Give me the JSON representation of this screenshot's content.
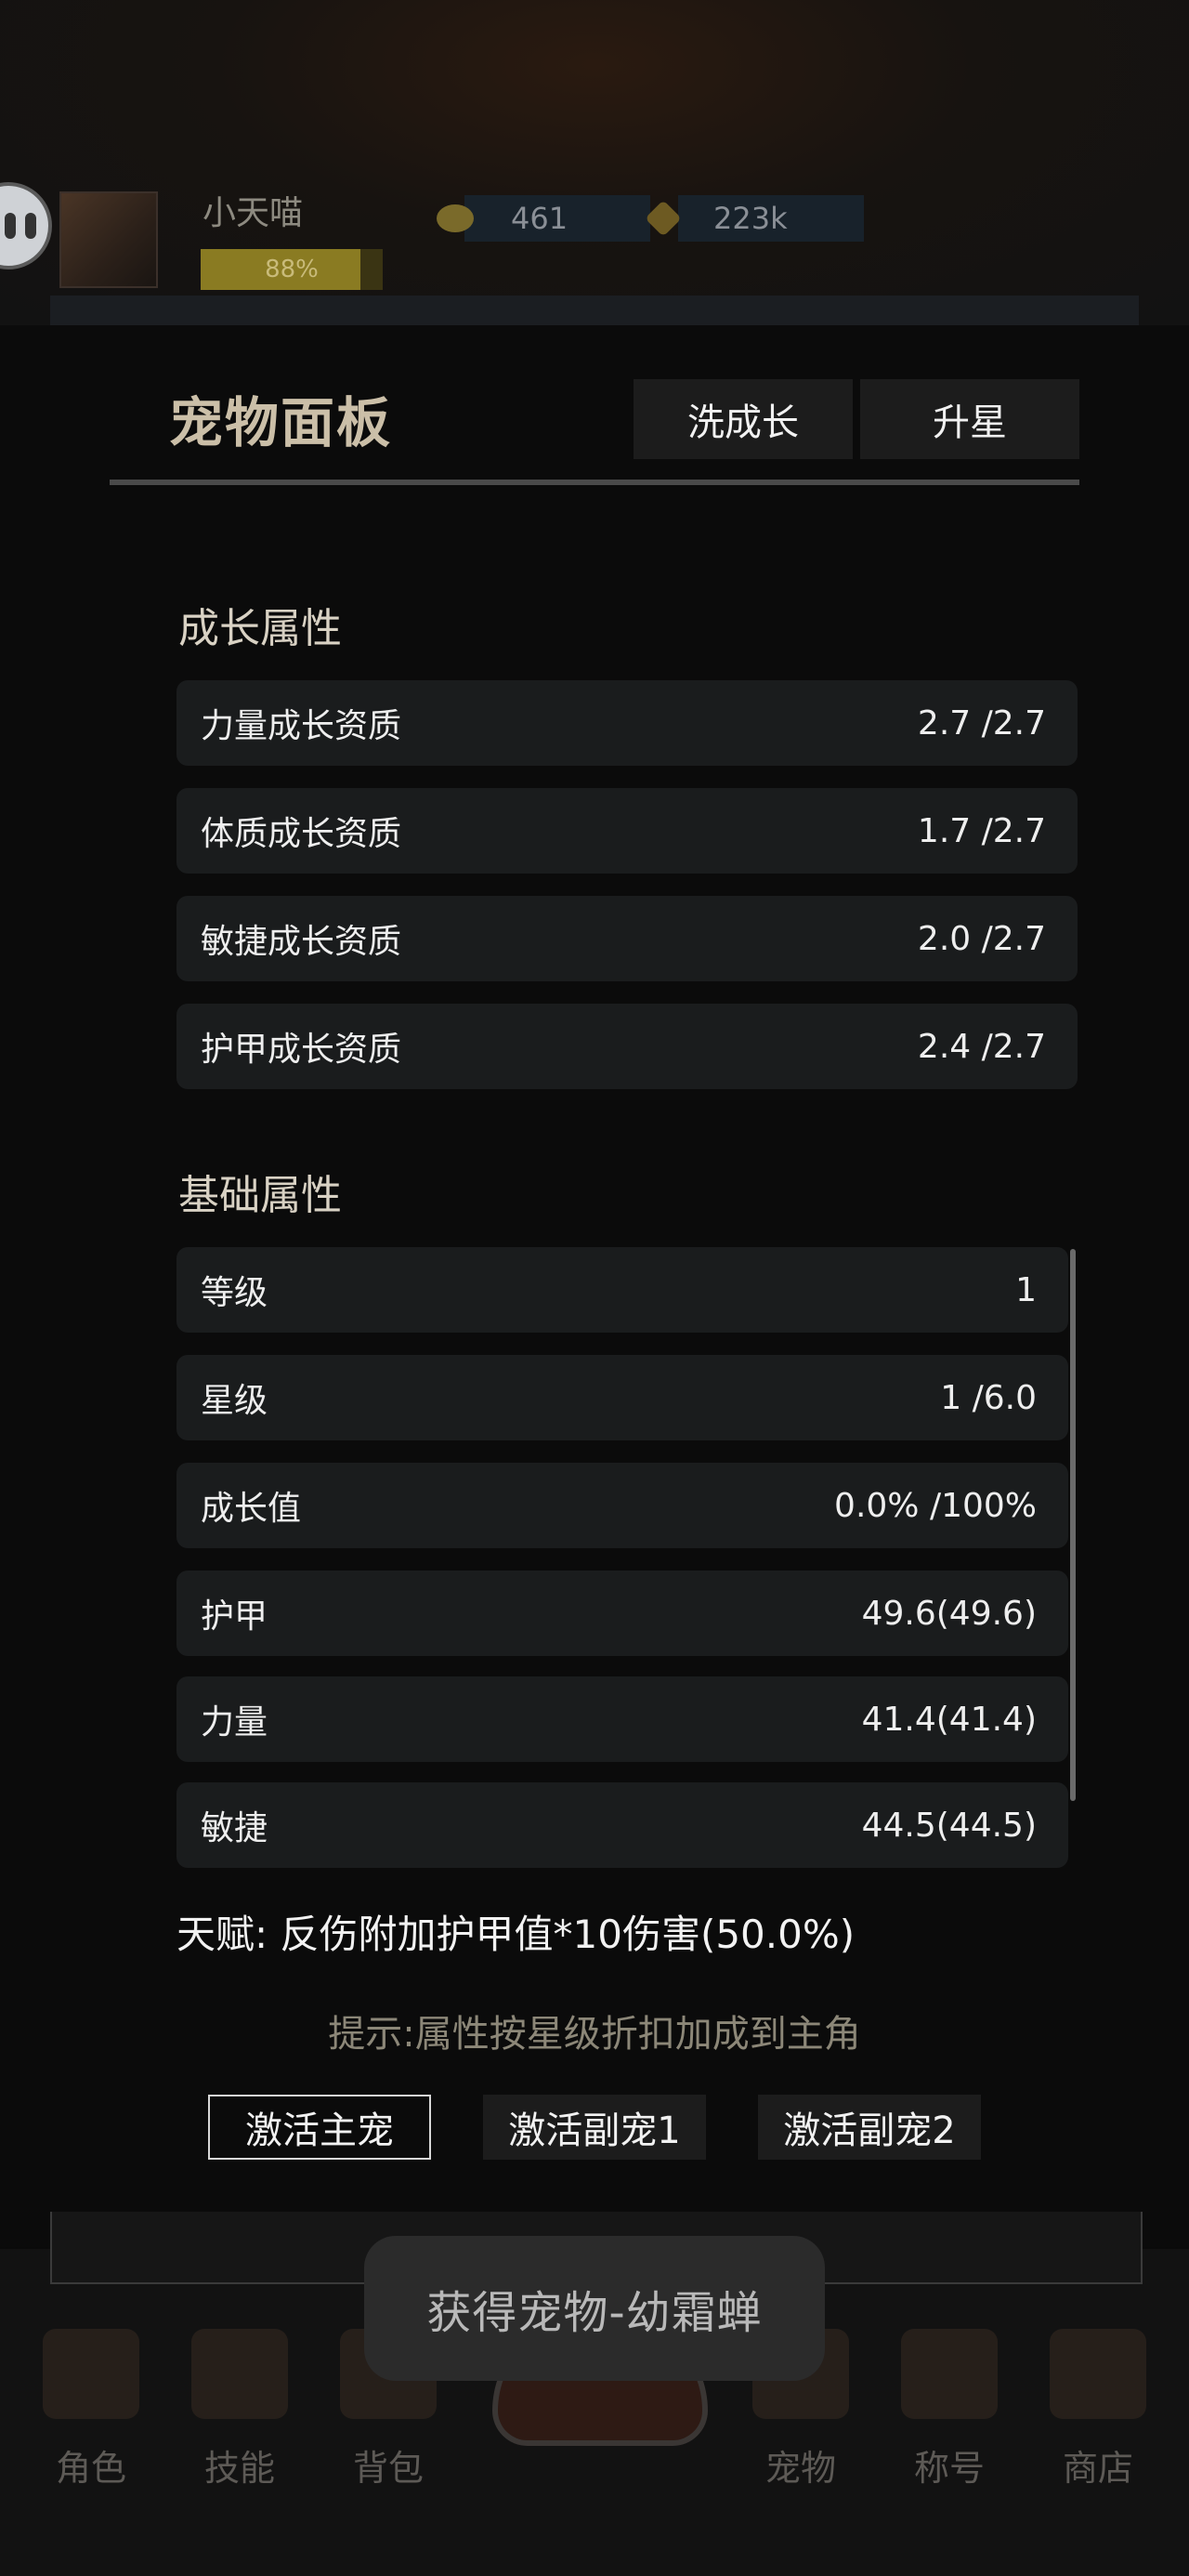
{
  "background": {
    "player_name": "小天喵",
    "exp_percent_text": "88%",
    "exp_fraction": 0.88,
    "currency_gold": "461",
    "currency_diamond": "223k",
    "nav": [
      {
        "label": "角色",
        "icon": "tent-icon"
      },
      {
        "label": "技能",
        "icon": "skill-book-icon"
      },
      {
        "label": "背包",
        "icon": "backpack-icon"
      },
      {
        "label": "宠物",
        "icon": "egg-icon"
      },
      {
        "label": "称号",
        "icon": "title-badge-icon"
      },
      {
        "label": "商店",
        "icon": "shop-icon"
      }
    ]
  },
  "panel": {
    "title": "宠物面板",
    "tabs": [
      "洗成长",
      "升星"
    ],
    "growth_section_title": "成长属性",
    "growth": [
      {
        "label": "力量成长资质",
        "value": "2.7  /2.7"
      },
      {
        "label": "体质成长资质",
        "value": "1.7  /2.7"
      },
      {
        "label": "敏捷成长资质",
        "value": "2.0  /2.7"
      },
      {
        "label": "护甲成长资质",
        "value": "2.4  /2.7"
      }
    ],
    "base_section_title": "基础属性",
    "base": [
      {
        "label": "等级",
        "value": "1"
      },
      {
        "label": "星级",
        "value": "1  /6.0"
      },
      {
        "label": "成长值",
        "value": "0.0%  /100%"
      },
      {
        "label": "护甲",
        "value": "49.6(49.6)"
      },
      {
        "label": "力量",
        "value": "41.4(41.4)"
      },
      {
        "label": "敏捷",
        "value": "44.5(44.5)"
      }
    ],
    "talent": "天赋:  反伤附加护甲值*10伤害(50.0%)",
    "hint": "提示:属性按星级折扣加成到主角",
    "actions": [
      "激活主宠",
      "激活副宠1",
      "激活副宠2"
    ]
  },
  "toast": "获得宠物-幼霜蝉"
}
